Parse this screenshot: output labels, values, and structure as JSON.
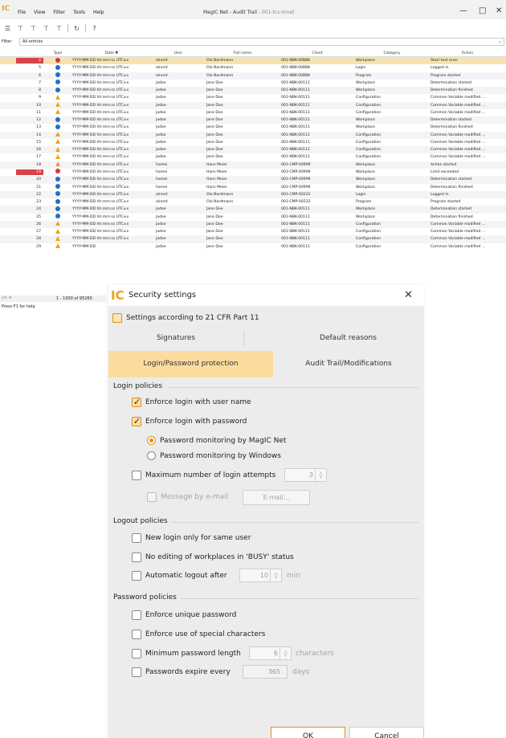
{
  "app": {
    "logo": "IC",
    "menu": [
      "File",
      "View",
      "Filter",
      "Tools",
      "Help"
    ],
    "title": "MagIC Net - Audit Trail",
    "subtitle": "- 001-tcv-mnet"
  },
  "toolbar": {
    "help_glyph": "?"
  },
  "filter": {
    "label": "Filter",
    "value": "All entries"
  },
  "table": {
    "columns": {
      "type": "Type",
      "date": "Date ▼",
      "user": "User",
      "full_name": "Full name",
      "client": "Client",
      "category": "Category",
      "action": "Action"
    },
    "rows": [
      {
        "num": "4",
        "type": "error",
        "date": "YYYY-MM-DD hh:mm:ss UTC±x",
        "user": "olnord",
        "name": "Ola Nordmann",
        "client": "001-NBK-00888",
        "category": "Workplace",
        "action": "Start test error"
      },
      {
        "num": "5",
        "type": "info",
        "date": "YYYY-MM-DD hh:mm:ss UTC±x",
        "user": "olnord",
        "name": "Ola Nordmann",
        "client": "001-NBK-00888",
        "category": "Login",
        "action": "Logged in"
      },
      {
        "num": "6",
        "type": "info",
        "date": "YYYY-MM-DD hh:mm:ss UTC±x",
        "user": "olnord",
        "name": "Ola Nordmann",
        "client": "001-NBK-00888",
        "category": "Program",
        "action": "Program started"
      },
      {
        "num": "7",
        "type": "info",
        "date": "YYYY-MM-DD hh:mm:ss UTC±x",
        "user": "jadoe",
        "name": "Jane Doe",
        "client": "001-NBK-00111",
        "category": "Workplace",
        "action": "Determination started"
      },
      {
        "num": "8",
        "type": "info",
        "date": "YYYY-MM-DD hh:mm:ss UTC±x",
        "user": "jadoe",
        "name": "Jane Doe",
        "client": "001-NBK-00111",
        "category": "Workplace",
        "action": "Determination finished"
      },
      {
        "num": "9",
        "type": "warn",
        "date": "YYYY-MM-DD hh:mm:ss UTC±x",
        "user": "jadoe",
        "name": "Jane Doe",
        "client": "001-NBK-00111",
        "category": "Configuration",
        "action": "Common Variable modified ..."
      },
      {
        "num": "10",
        "type": "warn",
        "date": "YYYY-MM-DD hh:mm:ss UTC±x",
        "user": "jadoe",
        "name": "Jane Doe",
        "client": "001-NBK-00111",
        "category": "Configuration",
        "action": "Common Variable modified ..."
      },
      {
        "num": "11",
        "type": "warn",
        "date": "YYYY-MM-DD hh:mm:ss UTC±x",
        "user": "jadoe",
        "name": "Jane Doe",
        "client": "001-NBK-00111",
        "category": "Configuration",
        "action": "Common Variable modified ..."
      },
      {
        "num": "12",
        "type": "info",
        "date": "YYYY-MM-DD hh:mm:ss UTC±x",
        "user": "jadoe",
        "name": "Jane Doe",
        "client": "001-NBK-00111",
        "category": "Workplace",
        "action": "Determination started"
      },
      {
        "num": "13",
        "type": "info",
        "date": "YYYY-MM-DD hh:mm:ss UTC±x",
        "user": "jadoe",
        "name": "Jane Doe",
        "client": "001-NBK-00111",
        "category": "Workplace",
        "action": "Determination finished"
      },
      {
        "num": "14",
        "type": "warn",
        "date": "YYYY-MM-DD hh:mm:ss UTC±x",
        "user": "jadoe",
        "name": "Jane Doe",
        "client": "001-NBK-00111",
        "category": "Configuration",
        "action": "Common Variable modified ..."
      },
      {
        "num": "15",
        "type": "warn",
        "date": "YYYY-MM-DD hh:mm:ss UTC±x",
        "user": "jadoe",
        "name": "Jane Doe",
        "client": "001-NBK-00111",
        "category": "Configuration",
        "action": "Common Variable modified ..."
      },
      {
        "num": "16",
        "type": "warn",
        "date": "YYYY-MM-DD hh:mm:ss UTC±x",
        "user": "jadoe",
        "name": "Jane Doe",
        "client": "001-NBK-00111",
        "category": "Configuration",
        "action": "Common Variable modified ..."
      },
      {
        "num": "17",
        "type": "warn",
        "date": "YYYY-MM-DD hh:mm:ss UTC±x",
        "user": "jadoe",
        "name": "Jane Doe",
        "client": "001-NBK-00111",
        "category": "Configuration",
        "action": "Common Variable modified ..."
      },
      {
        "num": "18",
        "type": "warn",
        "date": "YYYY-MM-DD hh:mm:ss UTC±x",
        "user": "hamei",
        "name": "Hans Meier",
        "client": "001-CMP-00999",
        "category": "Workplace",
        "action": "Action started"
      },
      {
        "num": "19",
        "type": "error",
        "date": "YYYY-MM-DD hh:mm:ss UTC±x",
        "user": "hamei",
        "name": "Hans Meier",
        "client": "001-CMP-00999",
        "category": "Workplace",
        "action": "Limit exceeded"
      },
      {
        "num": "20",
        "type": "info",
        "date": "YYYY-MM-DD hh:mm:ss UTC±x",
        "user": "hamei",
        "name": "Hans Meier",
        "client": "001-CMP-00999",
        "category": "Workplace",
        "action": "Determination started"
      },
      {
        "num": "21",
        "type": "info",
        "date": "YYYY-MM-DD hh:mm:ss UTC±x",
        "user": "hamei",
        "name": "Hans Meier",
        "client": "001-CMP-00999",
        "category": "Workplace",
        "action": "Determination finished"
      },
      {
        "num": "22",
        "type": "info",
        "date": "YYYY-MM-DD hh:mm:ss UTC±x",
        "user": "olnord",
        "name": "Ola Nordmann",
        "client": "001-CMP-00222",
        "category": "Login",
        "action": "Logged in"
      },
      {
        "num": "23",
        "type": "info",
        "date": "YYYY-MM-DD hh:mm:ss UTC±x",
        "user": "olnord",
        "name": "Ola Nordmann",
        "client": "001-CMP-00222",
        "category": "Program",
        "action": "Program started"
      },
      {
        "num": "24",
        "type": "info",
        "date": "YYYY-MM-DD hh:mm:ss UTC±x",
        "user": "jadoe",
        "name": "Jane Doe",
        "client": "001-NBK-00111",
        "category": "Workplace",
        "action": "Determination started"
      },
      {
        "num": "25",
        "type": "info",
        "date": "YYYY-MM-DD hh:mm:ss UTC±x",
        "user": "jadoe",
        "name": "Jane Doe",
        "client": "001-NBK-00111",
        "category": "Workplace",
        "action": "Determination finished"
      },
      {
        "num": "26",
        "type": "warn",
        "date": "YYYY-MM-DD hh:mm:ss UTC±x",
        "user": "jadoe",
        "name": "Jane Doe",
        "client": "001-NBK-00111",
        "category": "Configuration",
        "action": "Common Variable modified ..."
      },
      {
        "num": "27",
        "type": "warn",
        "date": "YYYY-MM-DD hh:mm:ss UTC±x",
        "user": "jadoe",
        "name": "Jane Doe",
        "client": "001-NBK-00111",
        "category": "Configuration",
        "action": "Common Variable modified ..."
      },
      {
        "num": "28",
        "type": "warn",
        "date": "YYYY-MM-DD hh:mm:ss UTC±x",
        "user": "jadoe",
        "name": "Jane Doe",
        "client": "001-NBK-00111",
        "category": "Configuration",
        "action": "Common Variable modified ..."
      },
      {
        "num": "29",
        "type": "warn",
        "date": "YYYY-MM-DD",
        "user": "jadoe",
        "name": "Jane Doe",
        "client": "001-NBK-00111",
        "category": "Configuration",
        "action": "Common Variable modified ..."
      }
    ],
    "row_counter": "1 - 1000 of 95260",
    "scroll_arrows": "|< <"
  },
  "statusbar": {
    "text": "Press F1 for help"
  },
  "dialog": {
    "logo": "IC",
    "title": "Security settings",
    "close_glyph": "✕",
    "cfr_label": "Settings according to 21 CFR Part 11",
    "tabs": {
      "signatures": "Signatures",
      "default_reasons": "Default reasons",
      "login_password": "Login/Password protection",
      "audit_trail": "Audit Trail/Modifications"
    },
    "login_policies": {
      "title": "Login policies",
      "enforce_user": "Enforce login with user name",
      "enforce_password": "Enforce login with password",
      "monitor_magic": "Password monitoring by MagIC Net",
      "monitor_windows": "Password monitoring by Windows",
      "max_attempts": "Maximum number of login attempts",
      "max_attempts_value": "3",
      "message_email": "Message by e-mail",
      "email_button": "E-mail..."
    },
    "logout_policies": {
      "title": "Logout policies",
      "new_login_same_user": "New login only for same user",
      "no_editing_busy": "No editing of workplaces in 'BUSY' status",
      "auto_logout": "Automatic logout after",
      "auto_logout_value": "10",
      "auto_logout_unit": "min"
    },
    "password_policies": {
      "title": "Password policies",
      "unique_password": "Enforce unique password",
      "special_chars": "Enforce use of special characters",
      "min_length": "Minimum password length",
      "min_length_value": "6",
      "min_length_unit": "characters",
      "expire": "Passwords expire every",
      "expire_value": "365",
      "expire_unit": "days"
    },
    "ok_label": "OK",
    "cancel_label": "Cancel"
  }
}
